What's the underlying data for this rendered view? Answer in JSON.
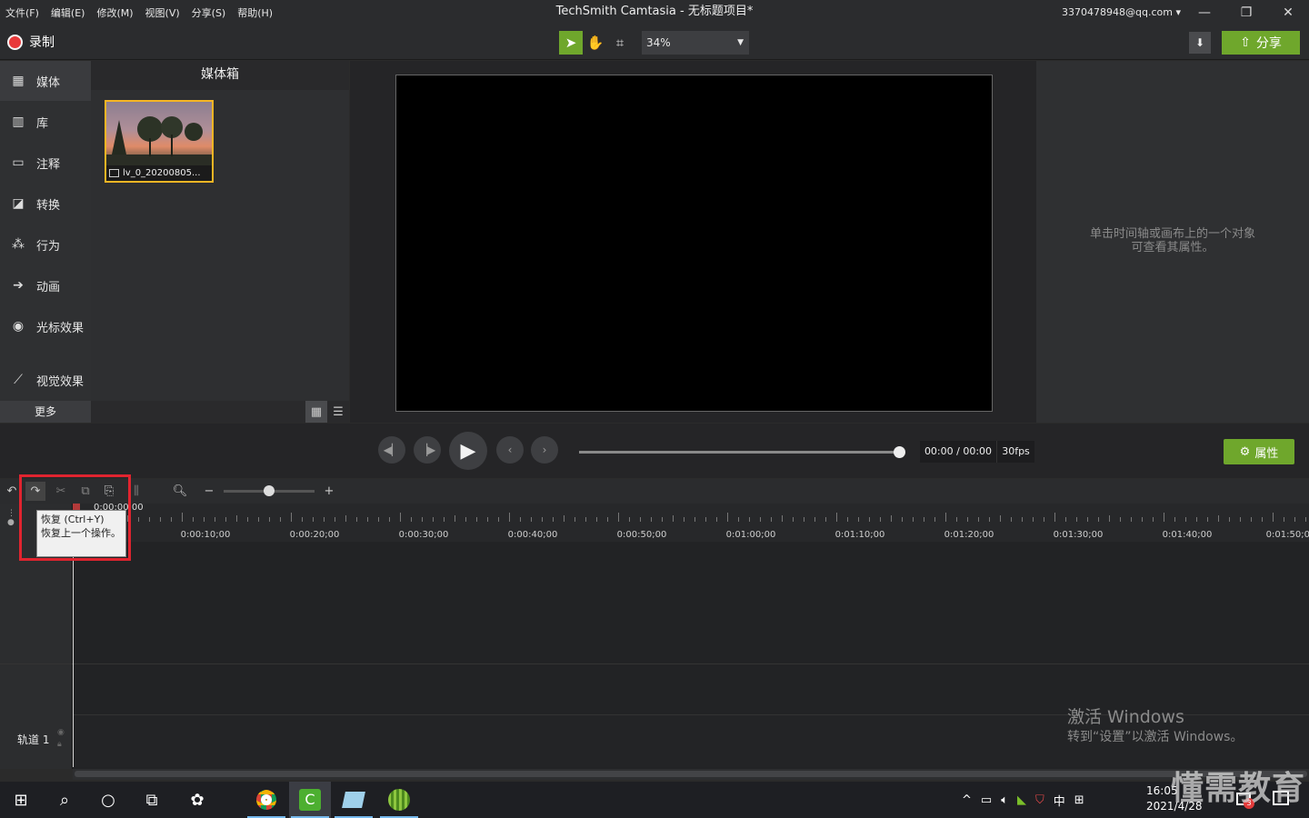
{
  "menu": [
    "文件(F)",
    "编辑(E)",
    "修改(M)",
    "视图(V)",
    "分享(S)",
    "帮助(H)"
  ],
  "window": {
    "title": "TechSmith Camtasia - 无标题项目*",
    "account": "3370478948@qq.com"
  },
  "toolbar": {
    "record_label": "录制",
    "zoom": "34%",
    "share_label": "分享"
  },
  "sidebar": {
    "items": [
      {
        "label": "媒体",
        "icon": "media-icon"
      },
      {
        "label": "库",
        "icon": "library-icon"
      },
      {
        "label": "注释",
        "icon": "annotation-icon"
      },
      {
        "label": "转换",
        "icon": "transition-icon"
      },
      {
        "label": "行为",
        "icon": "behavior-icon"
      },
      {
        "label": "动画",
        "icon": "animation-icon"
      },
      {
        "label": "光标效果",
        "icon": "cursor-effect-icon"
      },
      {
        "label": "视觉效果",
        "icon": "visual-effect-icon"
      }
    ],
    "more_label": "更多"
  },
  "bin": {
    "title": "媒体箱",
    "clip_name": "lv_0_20200805..."
  },
  "properties": {
    "empty_line1": "单击时间轴或画布上的一个对象",
    "empty_line2": "可查看其属性。",
    "button_label": "属性"
  },
  "player": {
    "timecode": "00:00 / 00:00",
    "fps": "30fps"
  },
  "timeline": {
    "tooltip_title": "恢复 (Ctrl+Y)",
    "tooltip_body": "恢复上一个操作。",
    "playhead_time": "0:00:00;00",
    "ruler_labels": [
      "0:00:10;00",
      "0:00:20;00",
      "0:00:30;00",
      "0:00:40;00",
      "0:00:50;00",
      "0:01:00;00",
      "0:01:10;00",
      "0:01:20;00",
      "0:01:30;00",
      "0:01:40;00",
      "0:01:50;00"
    ],
    "track_name": "轨道 1"
  },
  "watermark": {
    "line1": "激活 Windows",
    "line2": "转到“设置”以激活 Windows。"
  },
  "taskbar": {
    "ime": "中",
    "time": "16:05",
    "date": "2021/4/28",
    "badge": "3"
  },
  "brand_overlay": "懂需教育",
  "colors": {
    "accent_green": "#6fa72c",
    "record_red": "#e8393a",
    "clip_border": "#f5b524",
    "highlight_red": "#e0242f"
  }
}
